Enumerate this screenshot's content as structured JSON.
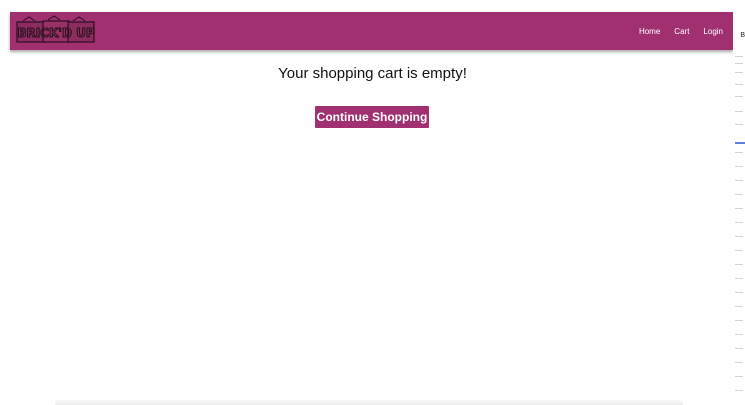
{
  "brand": {
    "logo_text": "BRICK'D UP",
    "primary_color": "#a0306f"
  },
  "nav": {
    "items": [
      {
        "label": "Home"
      },
      {
        "label": "Cart"
      },
      {
        "label": "Login"
      }
    ]
  },
  "cart": {
    "empty_message": "Your shopping cart is empty!",
    "continue_label": "Continue Shopping"
  },
  "sidebar_hint": {
    "letter": "B"
  }
}
